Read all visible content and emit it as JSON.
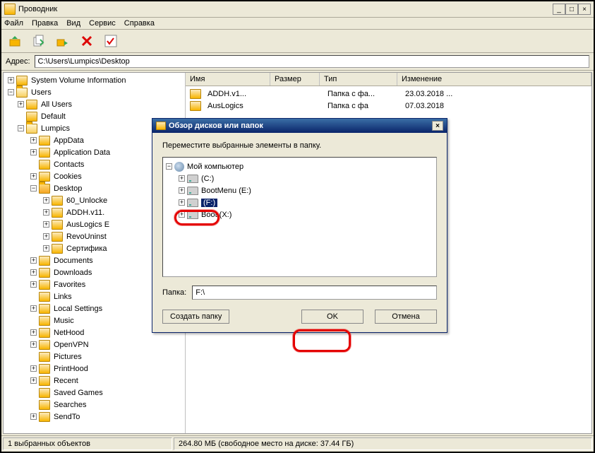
{
  "window": {
    "title": "Проводник",
    "minimize": "_",
    "maximize": "□",
    "close": "×"
  },
  "menu": {
    "file": "Файл",
    "edit": "Правка",
    "view": "Вид",
    "service": "Сервис",
    "help": "Справка"
  },
  "addressbar": {
    "label": "Адрес:",
    "value": "C:\\Users\\Lumpics\\Desktop"
  },
  "tree": {
    "sysvolinfo": "System Volume Information",
    "users": "Users",
    "allusers": "All Users",
    "default": "Default",
    "lumpics": "Lumpics",
    "appdata": "AppData",
    "appdata2": "Application Data",
    "contacts": "Contacts",
    "cookies": "Cookies",
    "desktop": "Desktop",
    "unlocke": "60_Unlocke",
    "addh": "ADDH.v11.",
    "auslogics_e": "AusLogics E",
    "revouninst": "RevoUninst",
    "cert": "Сертифика",
    "documents": "Documents",
    "downloads": "Downloads",
    "favorites": "Favorites",
    "links": "Links",
    "localsettings": "Local Settings",
    "music": "Music",
    "nethood": "NetHood",
    "openvpn": "OpenVPN",
    "pictures": "Pictures",
    "printhood": "PrintHood",
    "recent": "Recent",
    "savedgames": "Saved Games",
    "searches": "Searches",
    "sendto": "SendTo"
  },
  "list": {
    "cols": {
      "name": "Имя",
      "size": "Размер",
      "type": "Тип",
      "modified": "Изменение"
    },
    "rows": [
      {
        "name": "ADDH.v1...",
        "size": "",
        "type": "Папка с фа...",
        "modified": "23.03.2018 ..."
      },
      {
        "name": "AusLogics",
        "size": "",
        "type": "Папка с фа",
        "modified": "07.03.2018"
      }
    ]
  },
  "dialog": {
    "title": "Обзор дисков или папок",
    "message": "Переместите выбранные элементы в папку.",
    "close": "×",
    "tree": {
      "computer": "Мой компьютер",
      "c": "(C:)",
      "e": "BootMenu (E:)",
      "f": "(F:)",
      "x": "Boot (X:)"
    },
    "path_label": "Папка:",
    "path_value": "F:\\",
    "btn_create": "Создать папку",
    "btn_ok": "OK",
    "btn_cancel": "Отмена"
  },
  "statusbar": {
    "selected": "1 выбранных объектов",
    "space": "264.80 МБ (свободное место на диске: 37.44 ГБ)"
  }
}
